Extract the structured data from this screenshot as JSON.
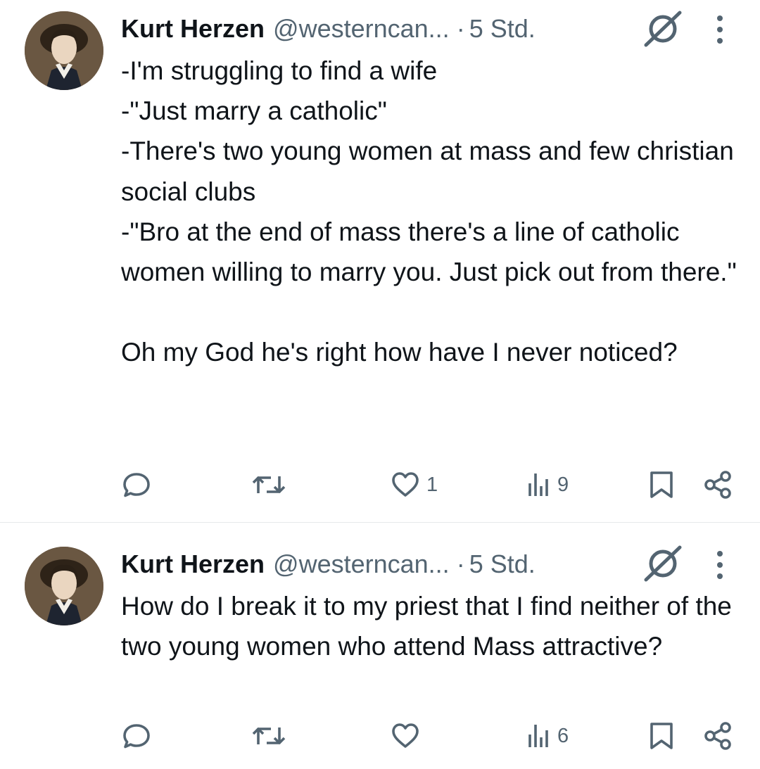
{
  "tweets": [
    {
      "author_name": "Kurt Herzen",
      "handle": "@westerncan...",
      "separator": "·",
      "time": "5 Std.",
      "text": "-I'm struggling to find a wife\n-\"Just marry a catholic\"\n-There's two young women at mass and few christian social clubs\n-\"Bro at the end of mass there's a line of catholic women willing to marry you. Just pick out from there.\"\n\nOh my God he's right how have I never noticed?",
      "likes": "1",
      "views": "9"
    },
    {
      "author_name": "Kurt Herzen",
      "handle": "@westerncan...",
      "separator": "·",
      "time": "5 Std.",
      "text": "How do I break it to my priest that I find neither of the two young women who attend Mass attractive?",
      "likes": "",
      "views": "6"
    }
  ],
  "icons": {
    "avatar": "avatar-portrait",
    "status": "no-entry-icon",
    "more": "more-vertical-icon",
    "reply": "reply-icon",
    "retweet": "retweet-icon",
    "like": "heart-icon",
    "views": "views-icon",
    "bookmark": "bookmark-icon",
    "share": "share-icon"
  },
  "colors": {
    "text": "#0f1419",
    "secondary": "#536471",
    "divider": "#e6e9eb"
  }
}
